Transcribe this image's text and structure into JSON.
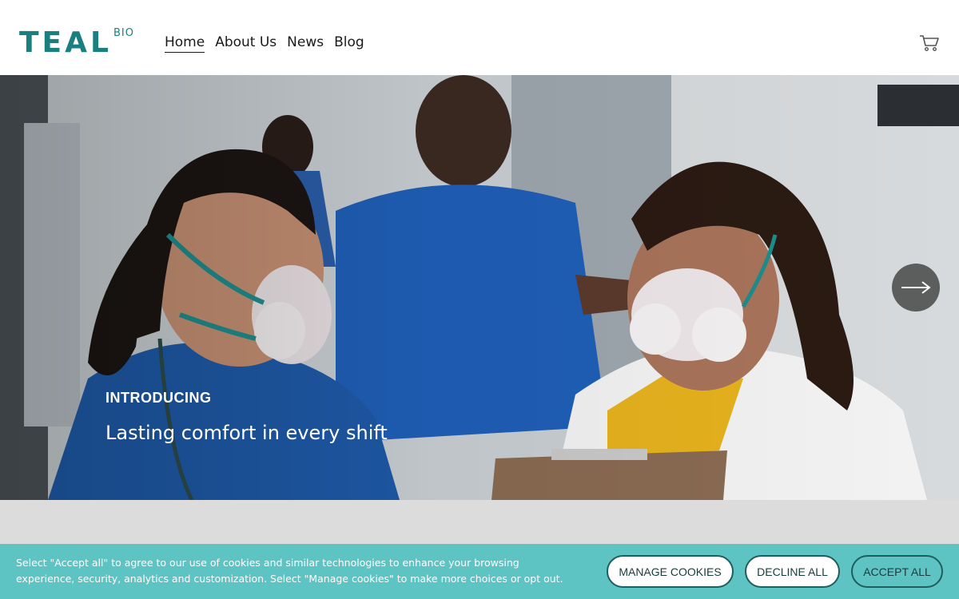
{
  "header": {
    "logo_main": "TEAL",
    "logo_sup": "BIO",
    "nav": [
      "Home",
      "About Us",
      "News",
      "Blog"
    ],
    "cart_icon": "cart-icon"
  },
  "hero": {
    "eyebrow": "INTRODUCING",
    "title": "Lasting comfort in every shift",
    "next_icon": "arrow-right-icon"
  },
  "cookie": {
    "text": "Select \"Accept all\" to agree to our use of cookies and similar technologies to enhance your browsing experience, security, analytics and customization. Select \"Manage cookies\" to make more choices or opt out.",
    "manage_label": "MANAGE COOKIES",
    "decline_label": "DECLINE ALL",
    "accept_label": "ACCEPT ALL"
  },
  "colors": {
    "brand": "#1a7f7f",
    "cookie_bar": "#5ec3c3"
  }
}
